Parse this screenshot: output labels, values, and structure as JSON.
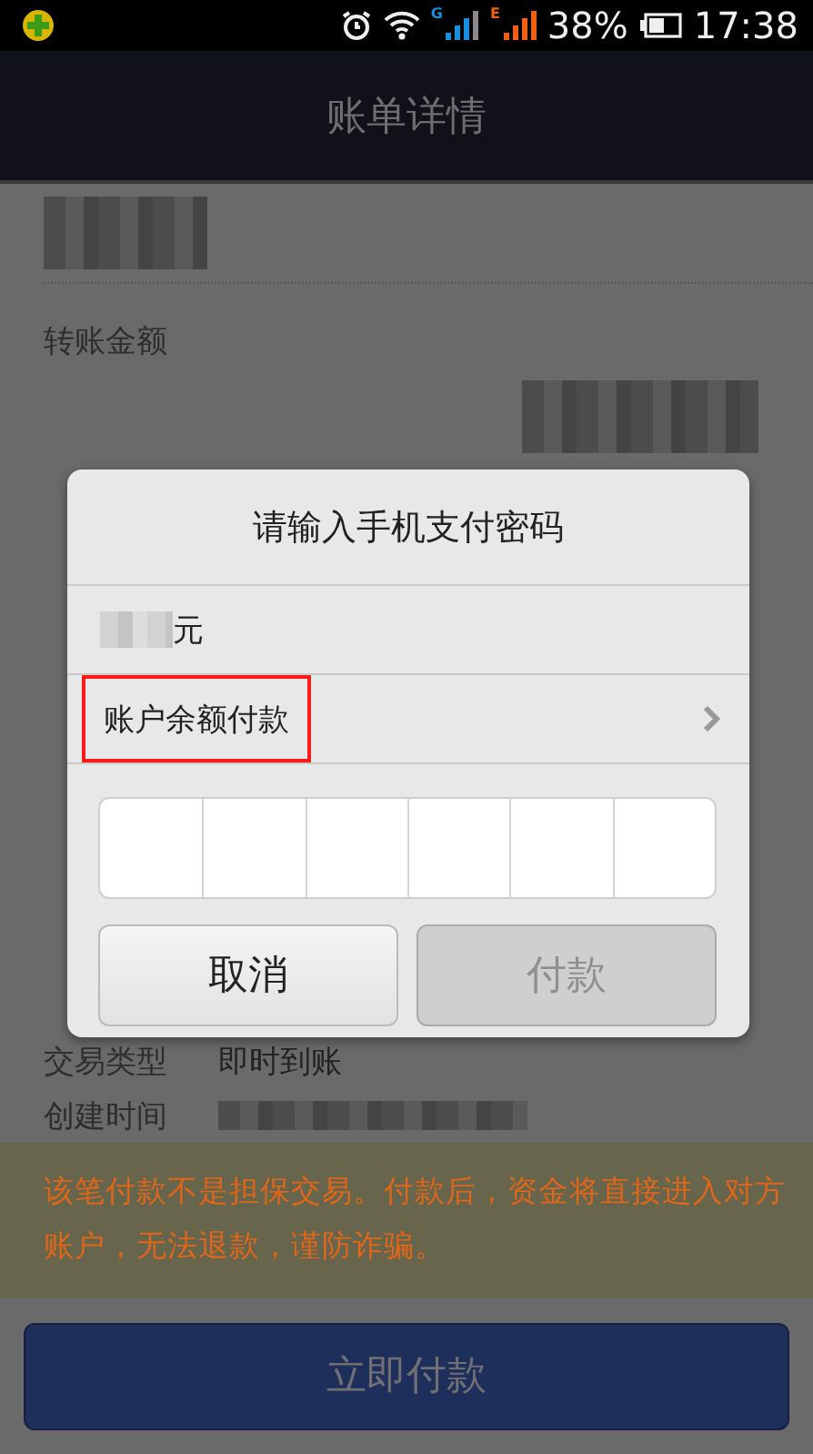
{
  "status_bar": {
    "network_1": "G",
    "network_2": "E",
    "battery": "38%",
    "time": "17:38"
  },
  "header": {
    "title": "账单详情"
  },
  "details": {
    "amount_label": "转账金额",
    "rows": [
      {
        "label": "交易类型",
        "value": "即时到账",
        "kind": "text"
      },
      {
        "label": "创建时间",
        "kind": "blurred"
      }
    ]
  },
  "warning": "该笔付款不是担保交易。付款后，资金将直接进入对方账户，无法退款，谨防诈骗。",
  "pay_now_button": "立即付款",
  "dialog": {
    "title": "请输入手机支付密码",
    "amount_unit": "元",
    "method": "账户余额付款",
    "method_highlighted": true,
    "buttons": [
      {
        "label": "取消",
        "disabled": false
      },
      {
        "label": "付款",
        "disabled": true
      }
    ]
  }
}
